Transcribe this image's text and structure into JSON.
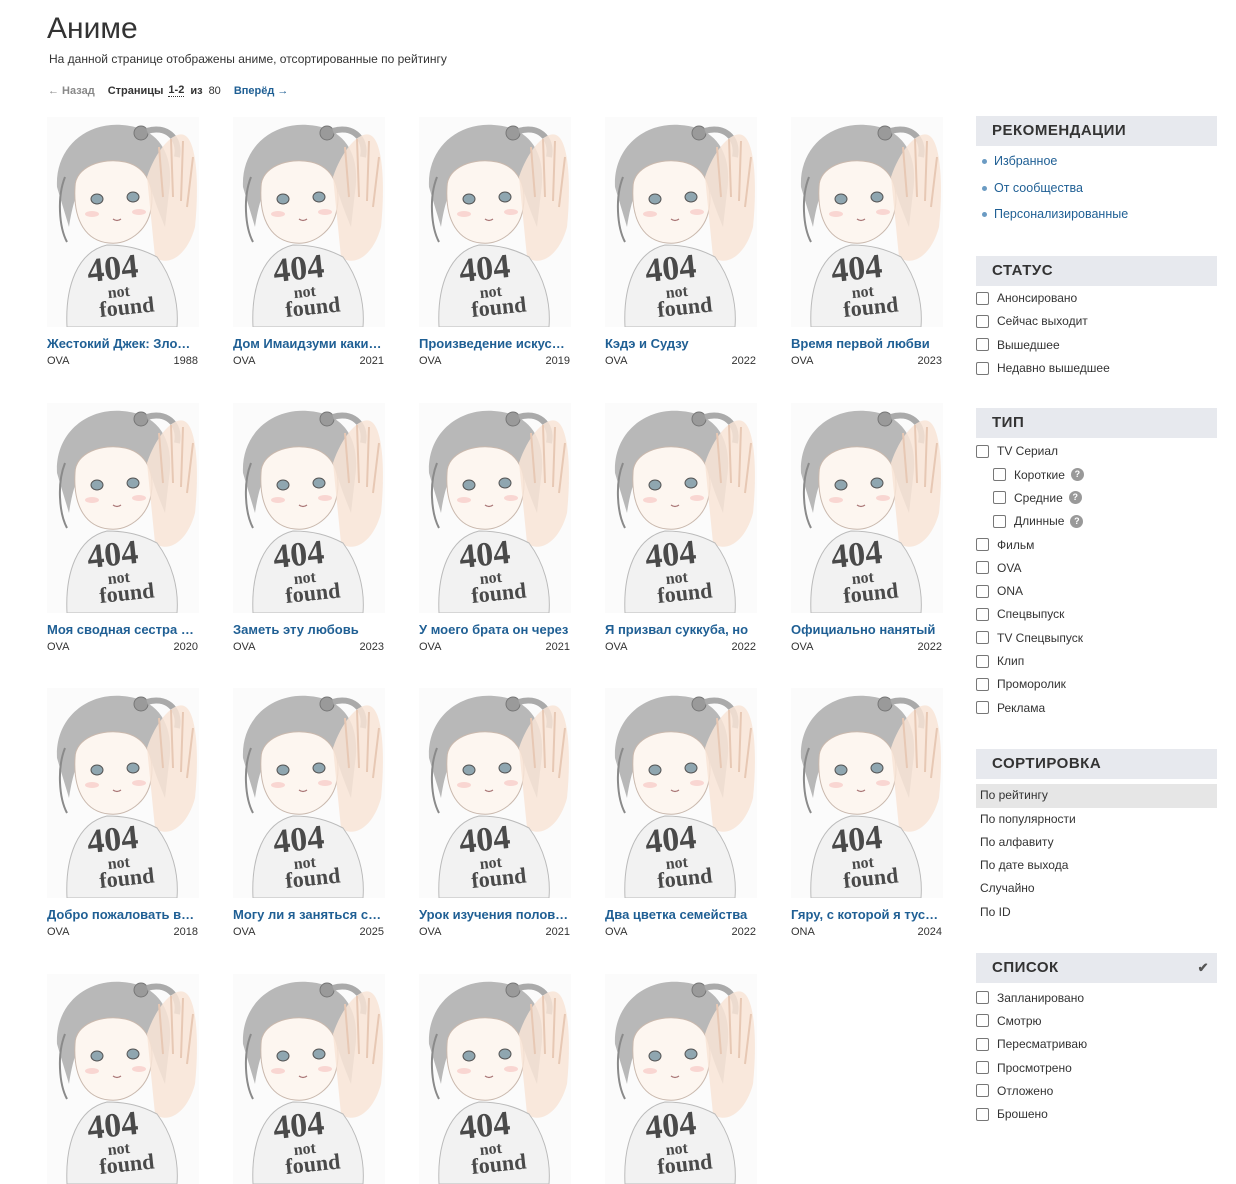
{
  "page": {
    "title": "Аниме",
    "subtitle": "На данной странице отображены аниме, отсортированные по рейтингу"
  },
  "pager": {
    "back": "← Назад",
    "label": "Страницы",
    "current": "1-2",
    "of": "из",
    "total": "80",
    "next": "Вперёд →"
  },
  "poster_icon": "404-not-found-placeholder",
  "cards": [
    {
      "title": "Жестокий Джек: Злодей-одиночка",
      "kind": "OVA",
      "year": "1988"
    },
    {
      "title": "Дом Имаидзуми каким-то образом",
      "kind": "OVA",
      "year": "2021"
    },
    {
      "title": "Произведение искусства",
      "kind": "OVA",
      "year": "2019"
    },
    {
      "title": "Кэдэ и Судзу",
      "kind": "OVA",
      "year": "2022"
    },
    {
      "title": "Время первой любви",
      "kind": "OVA",
      "year": "2023"
    },
    {
      "title": "Моя сводная сестра и я",
      "kind": "OVA",
      "year": "2020"
    },
    {
      "title": "Заметь эту любовь",
      "kind": "OVA",
      "year": "2023"
    },
    {
      "title": "У моего брата он через",
      "kind": "OVA",
      "year": "2021"
    },
    {
      "title": "Я призвал суккуба, но",
      "kind": "OVA",
      "year": "2022"
    },
    {
      "title": "Официально нанятый",
      "kind": "OVA",
      "year": "2022"
    },
    {
      "title": "Добро пожаловать в мир",
      "kind": "OVA",
      "year": "2018"
    },
    {
      "title": "Могу ли я заняться с тобой",
      "kind": "OVA",
      "year": "2025"
    },
    {
      "title": "Урок изучения половой",
      "kind": "OVA",
      "year": "2021"
    },
    {
      "title": "Два цветка семейства",
      "kind": "OVA",
      "year": "2022"
    },
    {
      "title": "Гяру, с которой я тусуюсь",
      "kind": "ONA",
      "year": "2024"
    },
    {
      "title": "",
      "kind": "",
      "year": ""
    },
    {
      "title": "",
      "kind": "",
      "year": ""
    },
    {
      "title": "",
      "kind": "",
      "year": ""
    },
    {
      "title": "",
      "kind": "",
      "year": ""
    }
  ],
  "sidebar": {
    "recommendations": {
      "title": "РЕКОМЕНДАЦИИ",
      "items": [
        "Избранное",
        "От сообщества",
        "Персонализированные"
      ]
    },
    "status": {
      "title": "СТАТУС",
      "items": [
        "Анонсировано",
        "Сейчас выходит",
        "Вышедшее",
        "Недавно вышедшее"
      ]
    },
    "type": {
      "title": "ТИП",
      "items": [
        "TV Сериал",
        "Короткие",
        "Средние",
        "Длинные",
        "Фильм",
        "OVA",
        "ONA",
        "Спецвыпуск",
        "TV Спецвыпуск",
        "Клип",
        "Проморолик",
        "Реклама"
      ],
      "help_icon": "?"
    },
    "sort": {
      "title": "СОРТИРОВКА",
      "items": [
        "По рейтингу",
        "По популярности",
        "По алфавиту",
        "По дате выхода",
        "Случайно",
        "По ID"
      ],
      "active": "По рейтингу"
    },
    "list": {
      "title": "СПИСОК",
      "check": "✔",
      "items": [
        "Запланировано",
        "Смотрю",
        "Пересматриваю",
        "Просмотрено",
        "Отложено",
        "Брошено"
      ]
    }
  }
}
